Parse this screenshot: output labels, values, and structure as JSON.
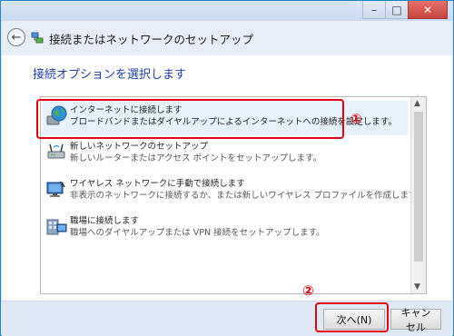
{
  "window": {
    "minimize_glyph": "–",
    "maximize_glyph": "□",
    "close_glyph": "✕",
    "title": "接続またはネットワークのセットアップ",
    "back_glyph": "←"
  },
  "main": {
    "heading": "接続オプションを選択します",
    "options": [
      {
        "title": "インターネットに接続します",
        "desc": "ブロードバンドまたはダイヤルアップによるインターネットへの接続を設定します。",
        "icon": "globe-icon",
        "selected": true
      },
      {
        "title": "新しいネットワークのセットアップ",
        "desc": "新しいルーターまたはアクセス ポイントをセットアップします。",
        "icon": "router-icon",
        "selected": false
      },
      {
        "title": "ワイヤレス ネットワークに手動で接続します",
        "desc": "非表示のネットワークに接続するか、または新しいワイヤレス プロファイルを作成します。",
        "icon": "wireless-monitor-icon",
        "selected": false
      },
      {
        "title": "職場に接続します",
        "desc": "職場へのダイヤルアップまたは VPN 接続をセットアップします。",
        "icon": "workplace-icon",
        "selected": false
      }
    ]
  },
  "footer": {
    "next_label": "次へ(N)",
    "cancel_label": "キャンセル"
  },
  "annotations": {
    "marker_1": "①",
    "marker_2": "②",
    "color": "#e60012"
  }
}
